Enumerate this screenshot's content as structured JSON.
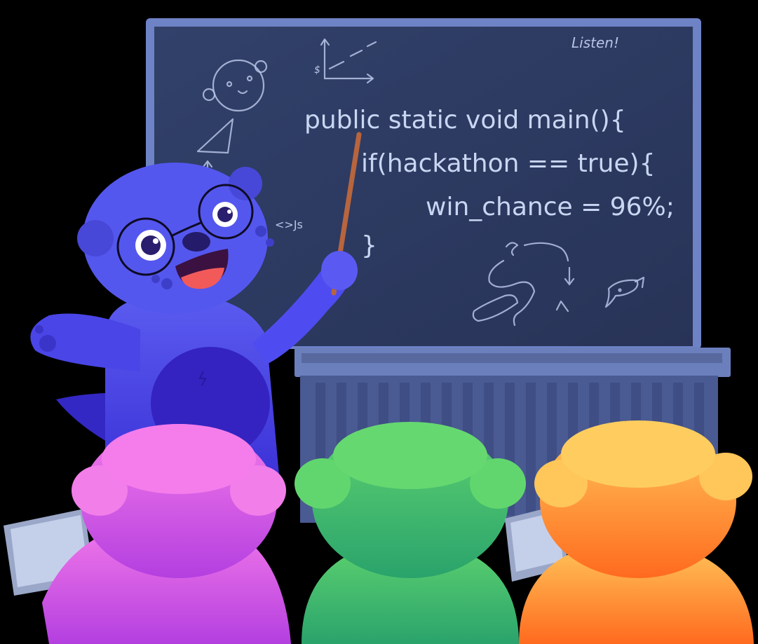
{
  "chalkboard": {
    "corner_note": "Listen!",
    "code_lines": [
      "public static void main(){",
      "if(hackathon == true){",
      "win_chance = 96%;",
      "}"
    ],
    "doodle_js": "<>Js"
  },
  "colors": {
    "board": "#27345a",
    "board_frame": "#6e82c6",
    "teacher": "#4a45e6",
    "student_pink": "#d24de6",
    "student_green": "#38b86a",
    "student_orange": "#ff8a2e"
  }
}
